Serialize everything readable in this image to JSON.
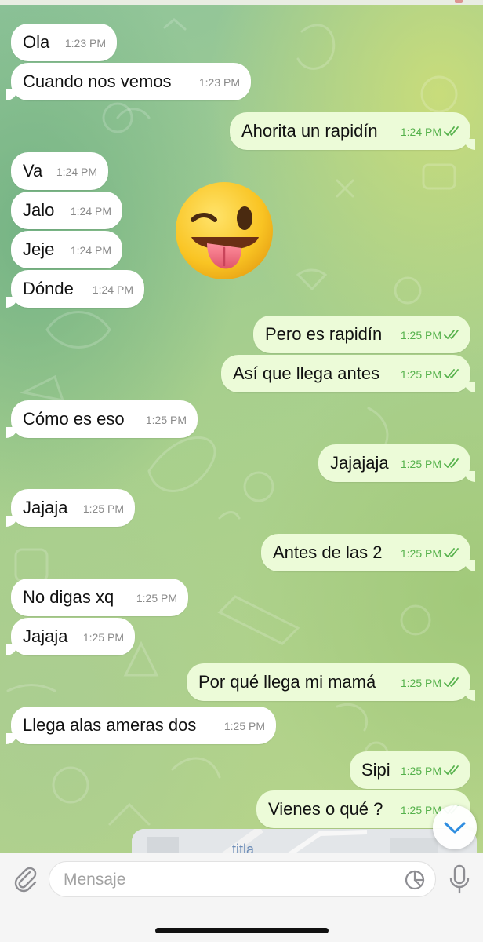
{
  "composer": {
    "placeholder": "Mensaje"
  },
  "map_preview_text": "titla",
  "messages": [
    {
      "dir": "in",
      "text": "Ola",
      "time": "1:23 PM"
    },
    {
      "dir": "in",
      "text": "Cuando nos vemos",
      "time": "1:23 PM"
    },
    {
      "dir": "out",
      "text": "Ahorita un rapidín",
      "time": "1:24 PM",
      "status": "read"
    },
    {
      "dir": "in",
      "text": "Va",
      "time": "1:24 PM"
    },
    {
      "dir": "in",
      "text": "Jalo",
      "time": "1:24 PM"
    },
    {
      "dir": "in",
      "text": "Jeje",
      "time": "1:24 PM"
    },
    {
      "dir": "in",
      "text": "Dónde",
      "time": "1:24 PM"
    },
    {
      "dir": "out",
      "text": "Pero es rapidín",
      "time": "1:25 PM",
      "status": "read"
    },
    {
      "dir": "out",
      "text": "Así que llega antes",
      "time": "1:25 PM",
      "status": "read"
    },
    {
      "dir": "in",
      "text": "Cómo es eso",
      "time": "1:25 PM"
    },
    {
      "dir": "out",
      "text": "Jajajaja",
      "time": "1:25 PM",
      "status": "read"
    },
    {
      "dir": "in",
      "text": "Jajaja",
      "time": "1:25 PM"
    },
    {
      "dir": "out",
      "text": "Antes de las 2",
      "time": "1:25 PM",
      "status": "read"
    },
    {
      "dir": "in",
      "text": "No digas xq",
      "time": "1:25 PM"
    },
    {
      "dir": "in",
      "text": "Jajaja",
      "time": "1:25 PM"
    },
    {
      "dir": "out",
      "text": "Por qué llega mi mamá",
      "time": "1:25 PM",
      "status": "read"
    },
    {
      "dir": "in",
      "text": "Llega alas ameras dos",
      "time": "1:25 PM"
    },
    {
      "dir": "out",
      "text": "Sipi",
      "time": "1:25 PM",
      "status": "read"
    },
    {
      "dir": "out",
      "text": "Vienes o qué ?",
      "time": "1:25 PM",
      "status": "read"
    }
  ],
  "sticker": {
    "icon": "winking-tongue-face-emoji"
  },
  "icons": {
    "attach": "paperclip-icon",
    "sticker": "sticker-icon",
    "mic": "microphone-icon",
    "scroll": "chevron-down-icon"
  },
  "colors": {
    "incoming_bubble": "#ffffff",
    "outgoing_bubble": "#ecfbd8",
    "outgoing_time": "#55b14b",
    "scroll_button_icon": "#2f8ee0"
  }
}
